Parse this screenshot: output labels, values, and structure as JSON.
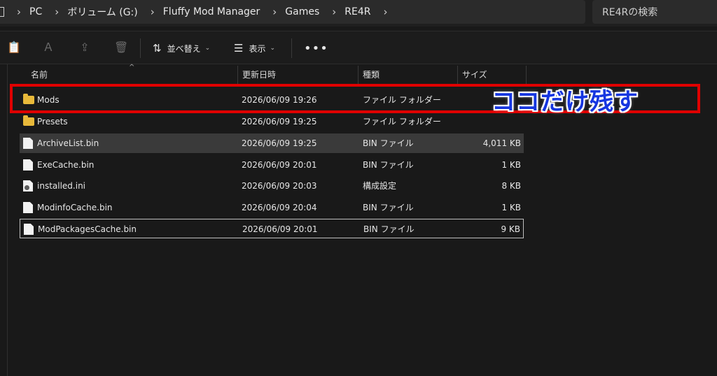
{
  "breadcrumb": [
    "PC",
    "ボリューム (G:)",
    "Fluffy Mod Manager",
    "Games",
    "RE4R"
  ],
  "search": {
    "placeholder": "RE4Rの検索"
  },
  "toolbar": {
    "sort_label": "並べ替え",
    "view_label": "表示"
  },
  "columns": {
    "name": "名前",
    "date": "更新日時",
    "type": "種類",
    "size": "サイズ"
  },
  "files": [
    {
      "name": "Mods",
      "date": "2026/06/09 19:26",
      "type": "ファイル フォルダー",
      "size": "",
      "icon": "folder-icon"
    },
    {
      "name": "Presets",
      "date": "2026/06/09 19:25",
      "type": "ファイル フォルダー",
      "size": "",
      "icon": "folder-icon"
    },
    {
      "name": "ArchiveList.bin",
      "date": "2026/06/09 19:25",
      "type": "BIN ファイル",
      "size": "4,011 KB",
      "icon": "file-icon"
    },
    {
      "name": "ExeCache.bin",
      "date": "2026/06/09 20:01",
      "type": "BIN ファイル",
      "size": "1 KB",
      "icon": "file-icon"
    },
    {
      "name": "installed.ini",
      "date": "2026/06/09 20:03",
      "type": "構成設定",
      "size": "8 KB",
      "icon": "settings-file-icon"
    },
    {
      "name": "ModinfoCache.bin",
      "date": "2026/06/09 20:04",
      "type": "BIN ファイル",
      "size": "1 KB",
      "icon": "file-icon"
    },
    {
      "name": "ModPackagesCache.bin",
      "date": "2026/06/09 20:01",
      "type": "BIN ファイル",
      "size": "9 KB",
      "icon": "file-icon"
    }
  ],
  "annotation": {
    "text": "ココだけ残す",
    "box_color": "#e00000",
    "text_color": "#1636e0"
  }
}
